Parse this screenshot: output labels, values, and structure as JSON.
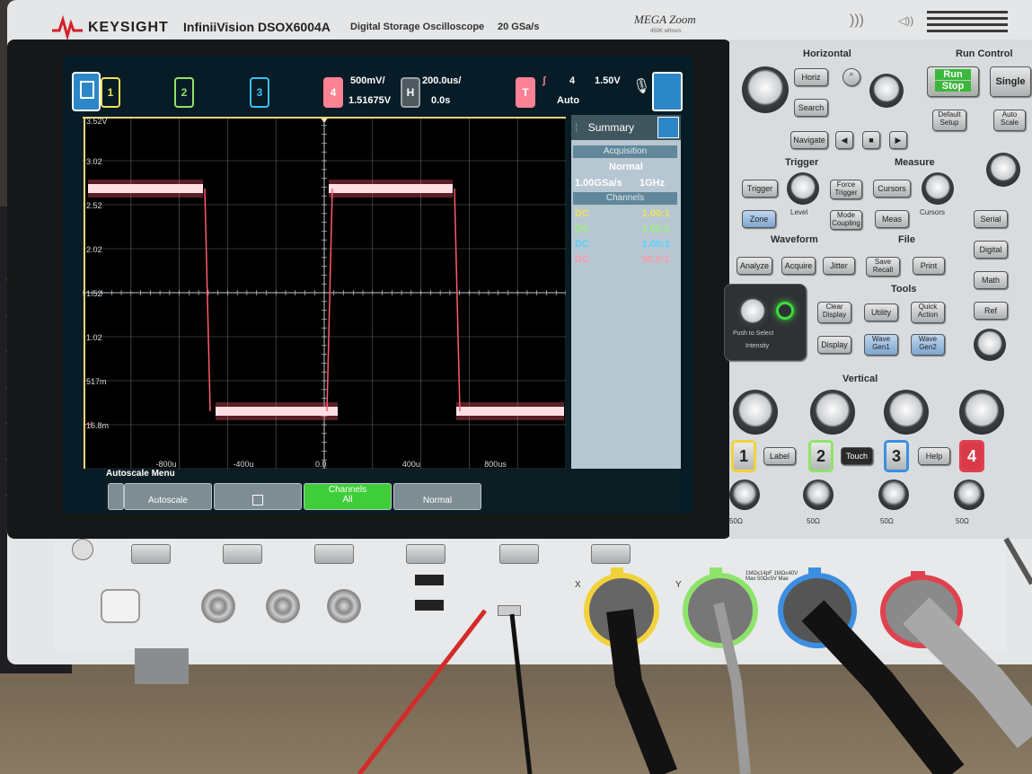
{
  "header": {
    "brand": "KEYSIGHT",
    "model": "InfiniiVision DSOX6004A",
    "description": "Digital Storage Oscilloscope",
    "sample_rate": "20 GSa/s",
    "megazoom": "MEGA Zoom",
    "megazoom_sub": "450K wfms/s"
  },
  "status": {
    "ch_labels": [
      "1",
      "2",
      "3",
      "4"
    ],
    "ch4_scale": "500mV/",
    "ch4_offset": "1.51675V",
    "horiz_letter": "H",
    "time_scale": "200.0us/",
    "time_offset": "0.0s",
    "trig_letter": "T",
    "trig_source": "4",
    "trig_level": "1.50V",
    "trig_mode": "Auto"
  },
  "plot": {
    "y_labels": [
      "3.52V",
      "3.02",
      "2.52",
      "2.02",
      "1.52",
      "1.02",
      "517m",
      "16.8m"
    ],
    "x_labels": [
      "-800u",
      "-400u",
      "0.0",
      "400u",
      "800us"
    ],
    "trace_color": "#ff5a6e",
    "grid_color": "#d8dde0"
  },
  "summary": {
    "title": "Summary",
    "acq_header": "Acquisition",
    "acq_mode": "Normal",
    "acq_rate": "1.00GSa/s",
    "acq_bw": "1GHz",
    "ch_header": "Channels",
    "channels": [
      {
        "coupling": "DC",
        "probe": "1.00:1",
        "color": "#f2e25a"
      },
      {
        "coupling": "DC",
        "probe": "1.00:1",
        "color": "#9ef07a"
      },
      {
        "coupling": "DC",
        "probe": "1.00:1",
        "color": "#5ad2ff"
      },
      {
        "coupling": "DC",
        "probe": "50.0:1",
        "color": "#ff9aa8"
      }
    ]
  },
  "menu": {
    "title": "Autoscale Menu",
    "autoscale": "Autoscale",
    "channels_label": "Channels",
    "channels_value": "All",
    "normal": "Normal"
  },
  "panel": {
    "horizontal": "Horizontal",
    "horiz": "Horiz",
    "search": "Search",
    "navigate": "Navigate",
    "run_control": "Run Control",
    "run": "Run",
    "stop": "Stop",
    "single": "Single",
    "default_setup": "Default Setup",
    "auto_scale": "Auto Scale",
    "trigger": "Trigger",
    "trigger_btn": "Trigger",
    "force_trigger": "Force Trigger",
    "level": "Level",
    "zone": "Zone",
    "mode_coupling": "Mode Coupling",
    "measure": "Measure",
    "cursors": "Cursors",
    "cursors_knob": "Cursors",
    "meas": "Meas",
    "waveform": "Waveform",
    "analyze": "Analyze",
    "acquire": "Acquire",
    "jitter": "Jitter",
    "file": "File",
    "save_recall": "Save Recall",
    "print": "Print",
    "tools": "Tools",
    "clear_display": "Clear Display",
    "utility": "Utility",
    "quick_action": "Quick Action",
    "display": "Display",
    "wave_gen1": "Wave Gen1",
    "wave_gen2": "Wave Gen2",
    "serial": "Serial",
    "digital": "Digital",
    "math": "Math",
    "ref": "Ref",
    "vertical": "Vertical",
    "label": "Label",
    "touch": "Touch",
    "help": "Help",
    "ch_numbers": [
      "1",
      "2",
      "3",
      "4"
    ],
    "ohm": "50Ω",
    "intensity": "Intensity",
    "push_select": "Push to Select"
  },
  "front": {
    "probe_rating": "1MΩ≤14pF 1MΩ≤40V Max 50Ω≤5V Max",
    "x_label": "X",
    "y_label": "Y"
  }
}
